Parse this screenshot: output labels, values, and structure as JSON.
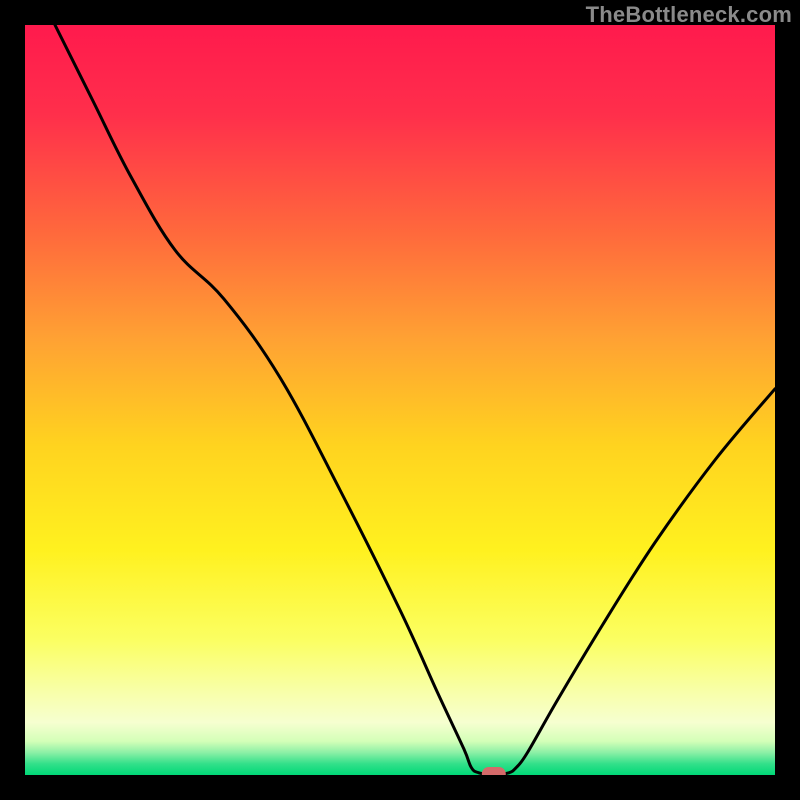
{
  "attribution": "TheBottleneck.com",
  "colors": {
    "frame": "#000000",
    "curve": "#000000",
    "marker_fill": "#d46a6a",
    "gradient_stops": [
      {
        "offset": 0.0,
        "color": "#ff1a4d"
      },
      {
        "offset": 0.12,
        "color": "#ff2f4b"
      },
      {
        "offset": 0.28,
        "color": "#ff6a3c"
      },
      {
        "offset": 0.42,
        "color": "#ffa233"
      },
      {
        "offset": 0.56,
        "color": "#ffd31f"
      },
      {
        "offset": 0.7,
        "color": "#fff11f"
      },
      {
        "offset": 0.82,
        "color": "#fbff62"
      },
      {
        "offset": 0.89,
        "color": "#f8ffaa"
      },
      {
        "offset": 0.93,
        "color": "#f6ffd0"
      },
      {
        "offset": 0.955,
        "color": "#d4ffb8"
      },
      {
        "offset": 0.97,
        "color": "#8cf0a6"
      },
      {
        "offset": 0.985,
        "color": "#33e08a"
      },
      {
        "offset": 1.0,
        "color": "#00d877"
      }
    ]
  },
  "chart_data": {
    "type": "line",
    "title": "",
    "xlabel": "",
    "ylabel": "",
    "x_range": [
      0,
      100
    ],
    "y_range": [
      0,
      100
    ],
    "marker": {
      "x": 62.5,
      "y": 0
    },
    "series": [
      {
        "name": "bottleneck-curve",
        "points": [
          {
            "x": 4.0,
            "y": 100.0
          },
          {
            "x": 9.0,
            "y": 90.0
          },
          {
            "x": 14.0,
            "y": 80.0
          },
          {
            "x": 20.0,
            "y": 70.0
          },
          {
            "x": 26.5,
            "y": 63.5
          },
          {
            "x": 34.0,
            "y": 53.0
          },
          {
            "x": 42.0,
            "y": 38.0
          },
          {
            "x": 50.0,
            "y": 22.0
          },
          {
            "x": 55.0,
            "y": 11.0
          },
          {
            "x": 58.5,
            "y": 3.5
          },
          {
            "x": 59.5,
            "y": 1.0
          },
          {
            "x": 60.5,
            "y": 0.3
          },
          {
            "x": 62.5,
            "y": 0.0
          },
          {
            "x": 64.5,
            "y": 0.3
          },
          {
            "x": 65.5,
            "y": 1.0
          },
          {
            "x": 67.0,
            "y": 3.0
          },
          {
            "x": 71.0,
            "y": 10.0
          },
          {
            "x": 77.0,
            "y": 20.0
          },
          {
            "x": 84.0,
            "y": 31.0
          },
          {
            "x": 92.0,
            "y": 42.0
          },
          {
            "x": 100.0,
            "y": 51.5
          }
        ]
      }
    ]
  }
}
